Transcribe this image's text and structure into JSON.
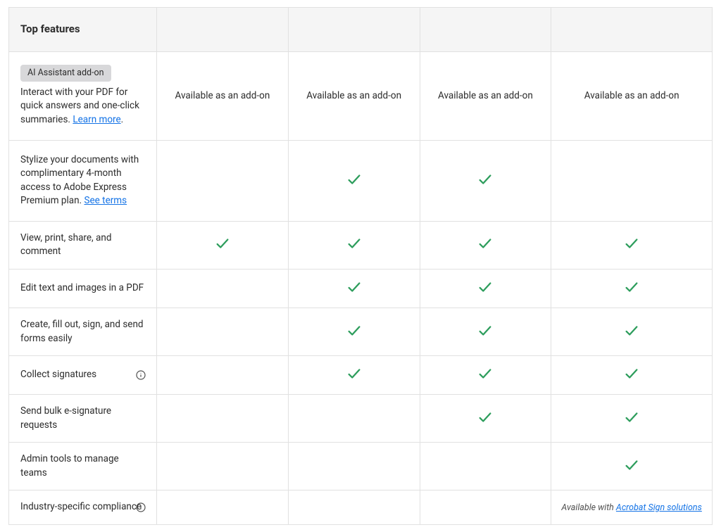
{
  "header": {
    "feature_col": "Top features"
  },
  "rows": [
    {
      "badge": "AI Assistant add-on",
      "desc": "Interact with your PDF for quick answers and one-click summaries.",
      "link": "Learn more",
      "info": false,
      "cells": [
        "text",
        "text",
        "text",
        "text"
      ],
      "text": "Available as an add-on"
    },
    {
      "desc": "Stylize your documents with complimentary 4-month access to Adobe Express Premium plan.",
      "link": "See terms",
      "info": false,
      "cells": [
        "",
        "check",
        "check",
        ""
      ]
    },
    {
      "desc": "View, print, share, and comment",
      "info": false,
      "cells": [
        "check",
        "check",
        "check",
        "check"
      ]
    },
    {
      "desc": "Edit text and images in a PDF",
      "info": false,
      "cells": [
        "",
        "check",
        "check",
        "check"
      ]
    },
    {
      "desc": "Create, fill out, sign, and send forms easily",
      "info": false,
      "cells": [
        "",
        "check",
        "check",
        "check"
      ]
    },
    {
      "desc": "Collect signatures",
      "info": true,
      "cells": [
        "",
        "check",
        "check",
        "check"
      ]
    },
    {
      "desc": "Send bulk e-signature requests",
      "info": false,
      "cells": [
        "",
        "",
        "check",
        "check"
      ]
    },
    {
      "desc": "Admin tools to manage teams",
      "info": false,
      "cells": [
        "",
        "",
        "",
        "check"
      ]
    },
    {
      "desc": "Industry-specific compliance",
      "info": true,
      "cells": [
        "",
        "",
        "",
        "note"
      ],
      "note_prefix": "Available with ",
      "note_link": "Acrobat Sign solutions"
    }
  ]
}
